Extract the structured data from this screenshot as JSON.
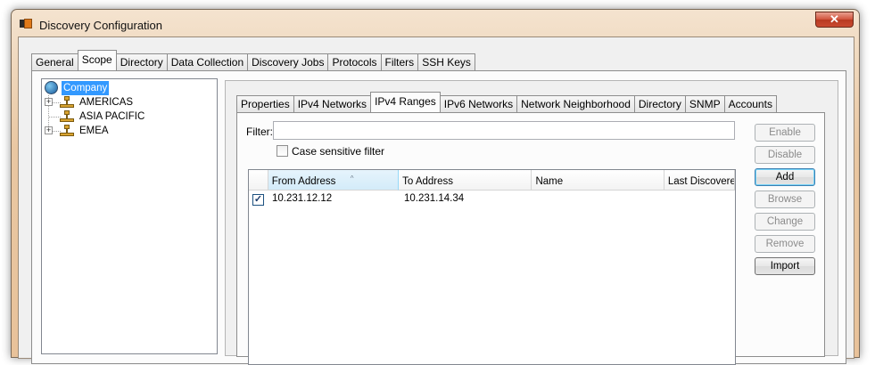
{
  "window": {
    "title": "Discovery Configuration",
    "close_glyph": "✕"
  },
  "main_tabs": [
    {
      "label": "General",
      "active": false
    },
    {
      "label": "Scope",
      "active": true
    },
    {
      "label": "Directory",
      "active": false
    },
    {
      "label": "Data Collection",
      "active": false
    },
    {
      "label": "Discovery Jobs",
      "active": false
    },
    {
      "label": "Protocols",
      "active": false
    },
    {
      "label": "Filters",
      "active": false
    },
    {
      "label": "SSH Keys",
      "active": false
    }
  ],
  "tree": {
    "root": {
      "label": "Company",
      "selected": true
    },
    "nodes": [
      {
        "label": "AMERICAS",
        "expandable": true,
        "expander": "+"
      },
      {
        "label": "ASIA PACIFIC",
        "expandable": false
      },
      {
        "label": "EMEA",
        "expandable": true,
        "expander": "+"
      }
    ]
  },
  "sub_tabs": [
    {
      "label": "Properties",
      "active": false
    },
    {
      "label": "IPv4 Networks",
      "active": false
    },
    {
      "label": "IPv4 Ranges",
      "active": true
    },
    {
      "label": "IPv6 Networks",
      "active": false
    },
    {
      "label": "Network Neighborhood",
      "active": false
    },
    {
      "label": "Directory",
      "active": false
    },
    {
      "label": "SNMP",
      "active": false
    },
    {
      "label": "Accounts",
      "active": false
    }
  ],
  "filter": {
    "label": "Filter:",
    "value": "",
    "case_sensitive_label": "Case sensitive filter",
    "case_sensitive_checked": false
  },
  "grid": {
    "columns": [
      "From Address",
      "To Address",
      "Name",
      "Last Discovered"
    ],
    "sort_glyph": "^",
    "rows": [
      {
        "checked": true,
        "check_glyph": "✓",
        "from": "10.231.12.12",
        "to": "10.231.14.34",
        "name": "",
        "last_discovered": ""
      }
    ]
  },
  "buttons": [
    {
      "label": "Enable",
      "enabled": false
    },
    {
      "label": "Disable",
      "enabled": false
    },
    {
      "label": "Add",
      "enabled": true,
      "default": true
    },
    {
      "label": "Browse",
      "enabled": false
    },
    {
      "label": "Change",
      "enabled": false
    },
    {
      "label": "Remove",
      "enabled": false
    },
    {
      "label": "Import",
      "enabled": true
    }
  ],
  "colors": {
    "selection": "#3399ff",
    "frame": "#e9c7a2",
    "close_button": "#c94a30"
  }
}
